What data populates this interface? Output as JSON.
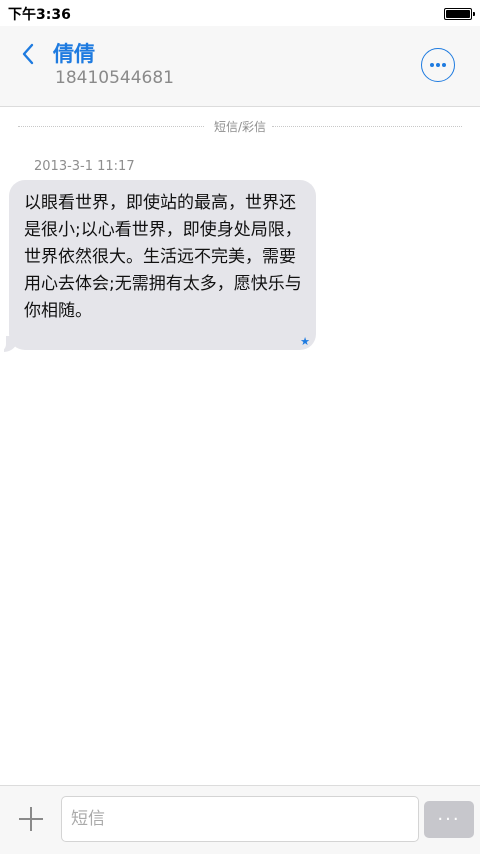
{
  "status_bar": {
    "time": "下午3:36",
    "battery_level": 1.0
  },
  "header": {
    "contact_name": "倩倩",
    "contact_number": "18410544681",
    "back_icon": "chevron-left-icon",
    "more_icon": "more-horizontal-icon"
  },
  "conversation": {
    "type_label": "短信/彩信",
    "messages": [
      {
        "timestamp": "2013-3-1 11:17",
        "text": "以眼看世界，即使站的最高，世界还是很小;以心看世界，即使身处局限，世界依然很大。生活远不完美，需要用心去体会;无需拥有太多，愿快乐与你相随。",
        "status_icon": "star-icon"
      }
    ]
  },
  "composer": {
    "placeholder": "短信",
    "value": "",
    "send_label": "...",
    "add_icon": "plus-icon"
  },
  "colors": {
    "accent": "#1e7be0",
    "bubble": "#e5e5ea",
    "send_button_disabled": "#c7c7cc"
  }
}
